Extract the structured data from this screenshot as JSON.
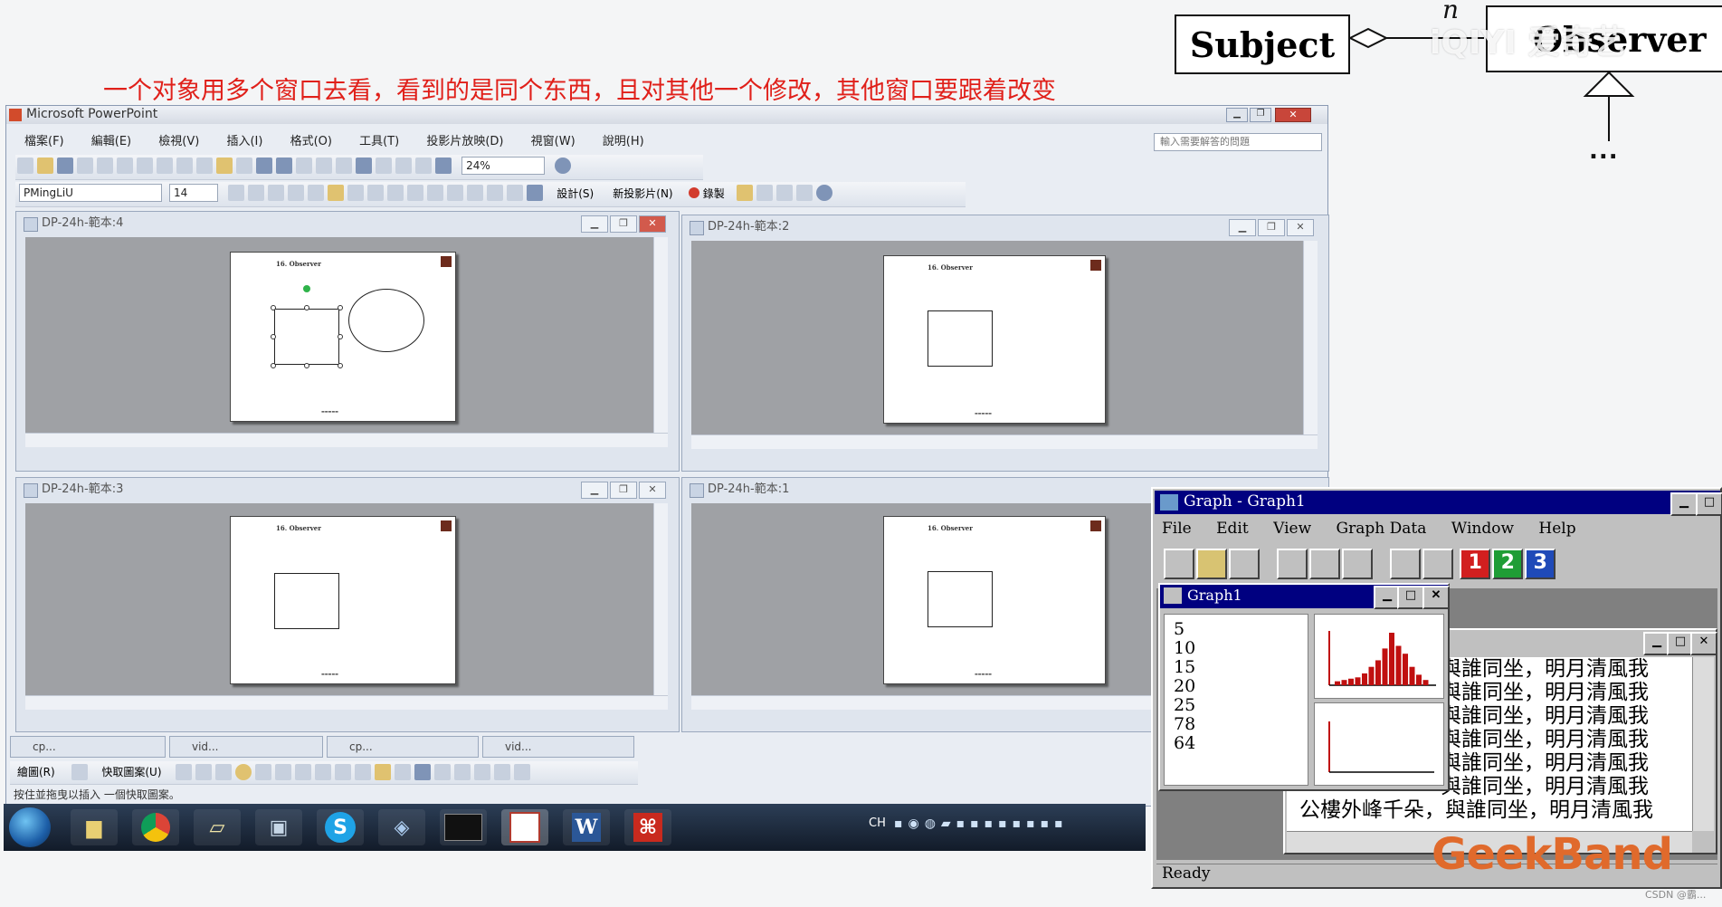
{
  "slide": {
    "caption": "一个对象用多个窗口去看，看到的是同个东西，且对其他一个修改，其他窗口要跟着改变",
    "uml": {
      "subject": "Subject",
      "observer": "Observer",
      "multiplicity": "n",
      "ellipsis": "..."
    },
    "watermark": "iQIYI 爱奇艺",
    "brand": "GeekBand",
    "credit": "CSDN @霸..."
  },
  "ppt": {
    "title": "Microsoft PowerPoint",
    "menu": [
      "檔案(F)",
      "編輯(E)",
      "檢視(V)",
      "插入(I)",
      "格式(O)",
      "工具(T)",
      "投影片放映(D)",
      "視窗(W)",
      "說明(H)"
    ],
    "help_placeholder": "輸入需要解答的問題",
    "zoom": "24%",
    "font_name": "PMingLiU",
    "font_size": "14",
    "design_button": "設計(S)",
    "new_slide_button": "新投影片(N)",
    "record_button": "錄製",
    "draw_menu": "繪圖(R)",
    "autoshapes_menu": "快取圖案(U)",
    "status_text": "按住並拖曳以插入 一個快取圖案。",
    "docs": [
      {
        "title": "DP-24h-範本:4"
      },
      {
        "title": "DP-24h-範本:2"
      },
      {
        "title": "DP-24h-範本:3"
      },
      {
        "title": "DP-24h-範本:1"
      }
    ],
    "slide_heading": "16. Observer",
    "minimized": [
      "cp...",
      "vid...",
      "cp...",
      "vid..."
    ]
  },
  "taskbar": {
    "lang": "CH"
  },
  "graph": {
    "title": "Graph - Graph1",
    "menu": [
      "File",
      "Edit",
      "View",
      "Graph Data",
      "Window",
      "Help"
    ],
    "child_title": "Graph1",
    "values": [
      "5",
      "10",
      "15",
      "20",
      "25",
      "78",
      "64"
    ],
    "toolbar_numbers": [
      "1",
      "2",
      "3"
    ],
    "status": "Ready",
    "text_lines": [
      "與誰同坐，明月清風我",
      "與誰同坐，明月清風我",
      "與誰同坐，明月清風我",
      "與誰同坐，明月清風我",
      "與誰同坐，明月清風我",
      "與誰同坐，明月清風我"
    ],
    "text_line_partial": "公樓外峰千朵，與誰同坐，明月清風我",
    "bars": [
      3,
      4,
      5,
      6,
      9,
      14,
      19,
      28,
      40,
      30,
      24,
      14,
      8,
      4
    ]
  }
}
